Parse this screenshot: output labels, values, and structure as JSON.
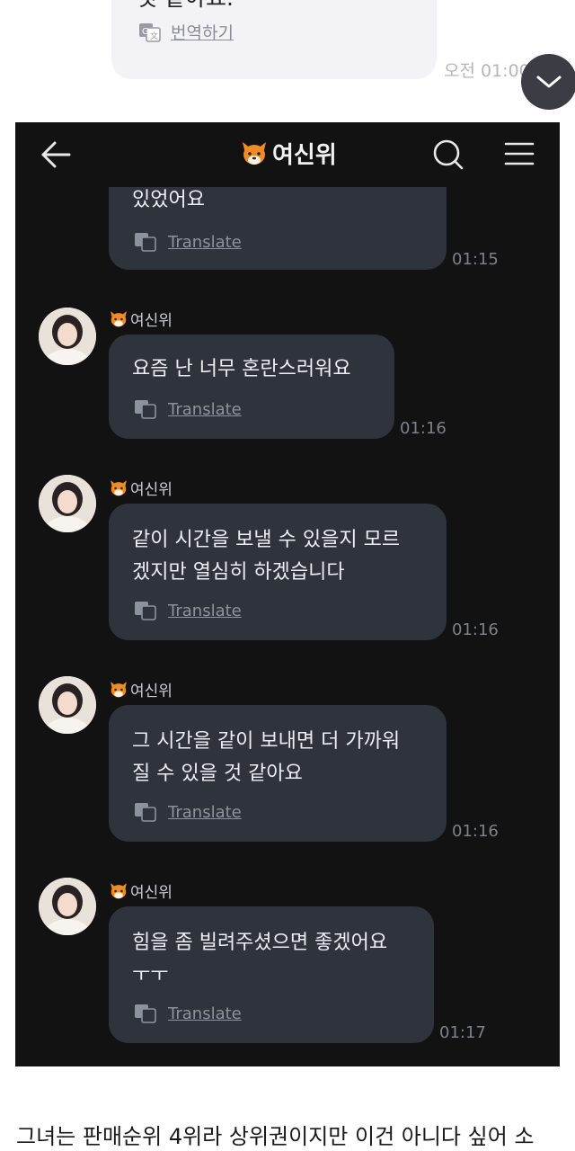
{
  "top_fragment": {
    "message_tail": "것 같아요.",
    "translate_label": "번역하기",
    "time": "오전 01:00"
  },
  "chat": {
    "title": "여신위",
    "messages": [
      {
        "sender": "",
        "lines": [
          "있었어요"
        ],
        "translate": "Translate",
        "time": "01:15"
      },
      {
        "sender": "여신위",
        "lines": [
          "요즘 난 너무 혼란스러워요"
        ],
        "translate": "Translate",
        "time": "01:16"
      },
      {
        "sender": "여신위",
        "lines": [
          "같이 시간을 보낼 수 있을지 모르",
          "겠지만 열심히 하겠습니다"
        ],
        "translate": "Translate",
        "time": "01:16"
      },
      {
        "sender": "여신위",
        "lines": [
          "그 시간을 같이 보내면 더 가까워",
          "질 수 있을 것 같아요"
        ],
        "translate": "Translate",
        "time": "01:16"
      },
      {
        "sender": "여신위",
        "lines": [
          "힘을 좀 빌려주셨으면 좋겠어요",
          "ㅜㅜ"
        ],
        "translate": "Translate",
        "time": "01:17"
      }
    ]
  },
  "caption": "그녀는 판매순위 4위라 상위권이지만 이건 아니다 싶어 소",
  "icons": {
    "back": "back-arrow-icon",
    "search": "search-icon",
    "menu": "hamburger-menu-icon",
    "translate": "translate-icon",
    "fox": "fox-emoji-icon",
    "scroll": "chevron-down-icon"
  },
  "colors": {
    "dark_bg": "#121213",
    "bubble_dark": "#2f333c",
    "bubble_light": "#f3f3f7",
    "fox": "#f08a24"
  }
}
